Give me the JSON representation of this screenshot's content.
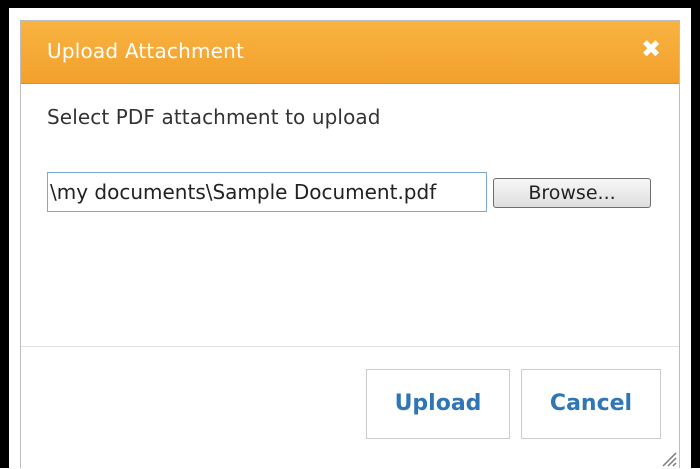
{
  "dialog": {
    "title": "Upload Attachment",
    "close_icon": "close-icon",
    "prompt": "Select PDF attachment to upload",
    "file_input": {
      "value": "\\my documents\\Sample Document.pdf"
    },
    "browse_label": "Browse...",
    "buttons": {
      "upload_label": "Upload",
      "cancel_label": "Cancel"
    },
    "colors": {
      "titlebar": "#f3a02c",
      "button_text": "#2f76b5"
    }
  }
}
